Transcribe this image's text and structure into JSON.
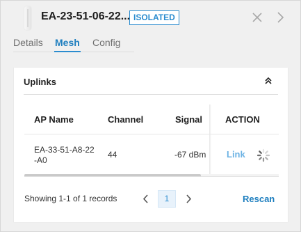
{
  "header": {
    "device_name": "EA-23-51-06-22...",
    "status_badge": "ISOLATED",
    "icons": [
      "device-icon",
      "close-icon",
      "chevron-right-icon"
    ]
  },
  "tabs": [
    {
      "label": "Details",
      "active": false
    },
    {
      "label": "Mesh",
      "active": true
    },
    {
      "label": "Config",
      "active": false
    }
  ],
  "uplinks": {
    "title": "Uplinks",
    "collapse_icon": "chevron-double-up-icon",
    "columns": [
      "AP Name",
      "Channel",
      "Signal",
      "ACTION"
    ],
    "rows": [
      {
        "ap_name": "EA-33-51-A8-22-A0",
        "channel": "44",
        "signal": "-67 dBm",
        "action_label": "Link",
        "action_icon": "spinner-icon"
      }
    ],
    "records_text": "Showing 1-1 of 1 records",
    "pagination": {
      "current_page": "1"
    },
    "rescan_label": "Rescan"
  },
  "colors": {
    "accent": "#2b8ccf",
    "link_light": "#6db3e4",
    "background": "#f0f0f0",
    "card": "#ffffff"
  }
}
